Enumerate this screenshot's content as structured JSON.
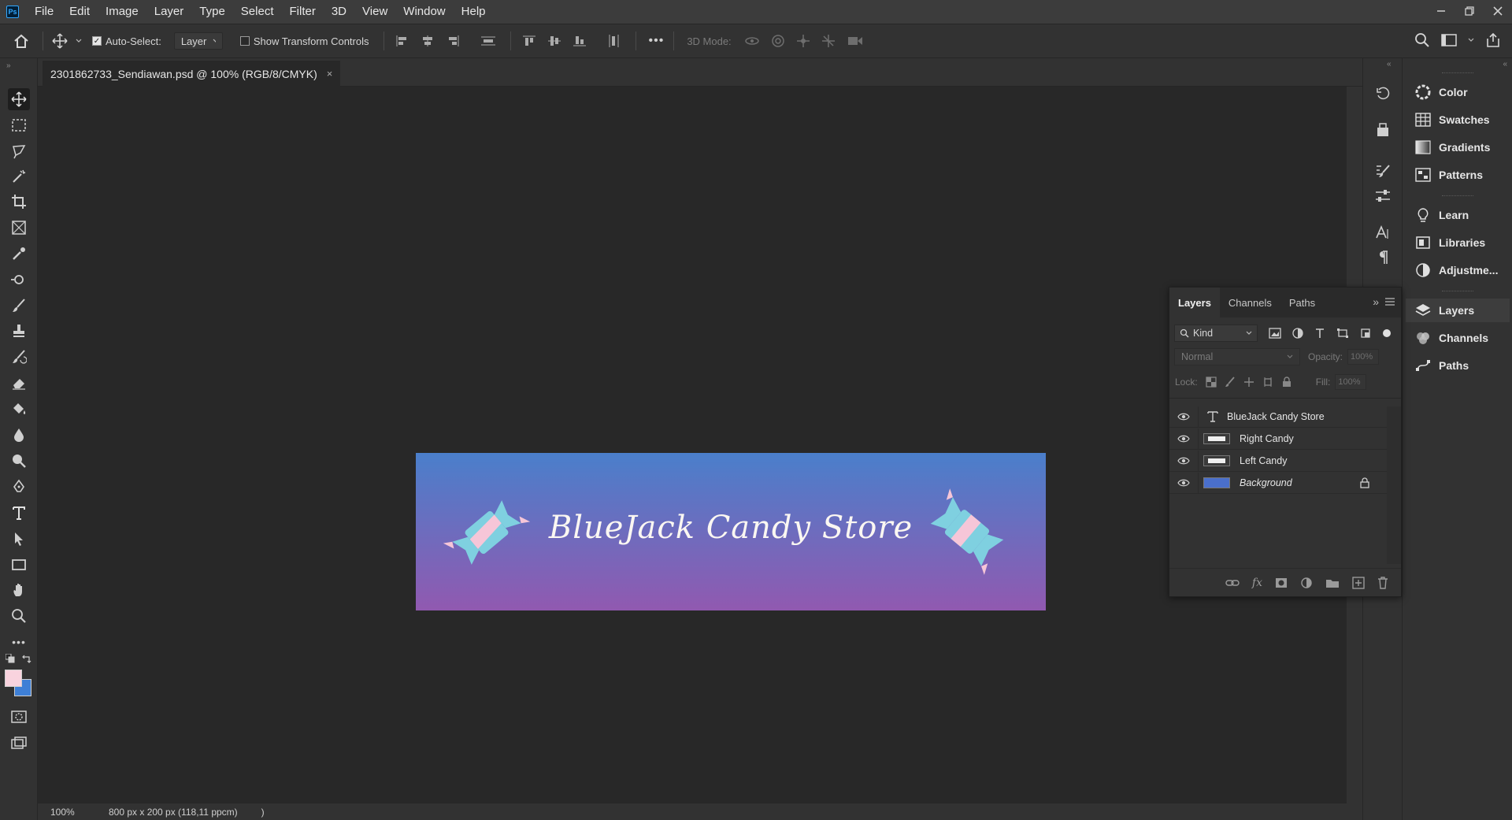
{
  "menubar": {
    "logo": "Ps",
    "items": [
      "File",
      "Edit",
      "Image",
      "Layer",
      "Type",
      "Select",
      "Filter",
      "3D",
      "View",
      "Window",
      "Help"
    ],
    "window_controls": [
      "minimize-icon",
      "restore-icon",
      "close-icon"
    ]
  },
  "options": {
    "auto_select_label": "Auto-Select:",
    "auto_select_checked": true,
    "auto_select_target": "Layer",
    "show_transform_label": "Show Transform Controls",
    "show_transform_checked": false,
    "mode_3d_label": "3D Mode:",
    "more_label": "•••"
  },
  "document": {
    "tab_title": "2301862733_Sendiawan.psd @ 100% (RGB/8/CMYK)",
    "close_glyph": "×"
  },
  "canvas": {
    "banner_text": "BlueJack Candy Store",
    "gradient_top": "#4a7fcb",
    "gradient_bottom": "#9159b0",
    "candy_blue": "#7fd0e0",
    "candy_pink": "#f6c6d8"
  },
  "status": {
    "zoom": "100%",
    "doc_info": "800 px x 200 px (118,11 ppcm)",
    "arrow": ")"
  },
  "toolbar": {
    "foreground_color": "#f9d3de",
    "background_color": "#3e7fd6"
  },
  "dock": {
    "items": [
      {
        "label": "Color",
        "icon": "color-wheel-icon"
      },
      {
        "label": "Swatches",
        "icon": "swatches-grid-icon"
      },
      {
        "label": "Gradients",
        "icon": "gradient-icon"
      },
      {
        "label": "Patterns",
        "icon": "patterns-icon"
      },
      {
        "label": "Learn",
        "icon": "lightbulb-icon"
      },
      {
        "label": "Libraries",
        "icon": "libraries-icon"
      },
      {
        "label": "Adjustme...",
        "icon": "adjustments-icon"
      },
      {
        "label": "Layers",
        "icon": "layers-icon"
      },
      {
        "label": "Channels",
        "icon": "channels-icon"
      },
      {
        "label": "Paths",
        "icon": "paths-icon"
      }
    ]
  },
  "layers_panel": {
    "tabs": [
      "Layers",
      "Channels",
      "Paths"
    ],
    "filter_label": "Kind",
    "blend_mode": "Normal",
    "opacity_label": "Opacity:",
    "opacity_value": "100%",
    "lock_label": "Lock:",
    "fill_label": "Fill:",
    "fill_value": "100%",
    "layers": [
      {
        "name": "BlueJack Candy Store",
        "type": "text"
      },
      {
        "name": "Right Candy",
        "type": "image"
      },
      {
        "name": "Left Candy",
        "type": "image"
      },
      {
        "name": "Background",
        "type": "background"
      }
    ]
  }
}
